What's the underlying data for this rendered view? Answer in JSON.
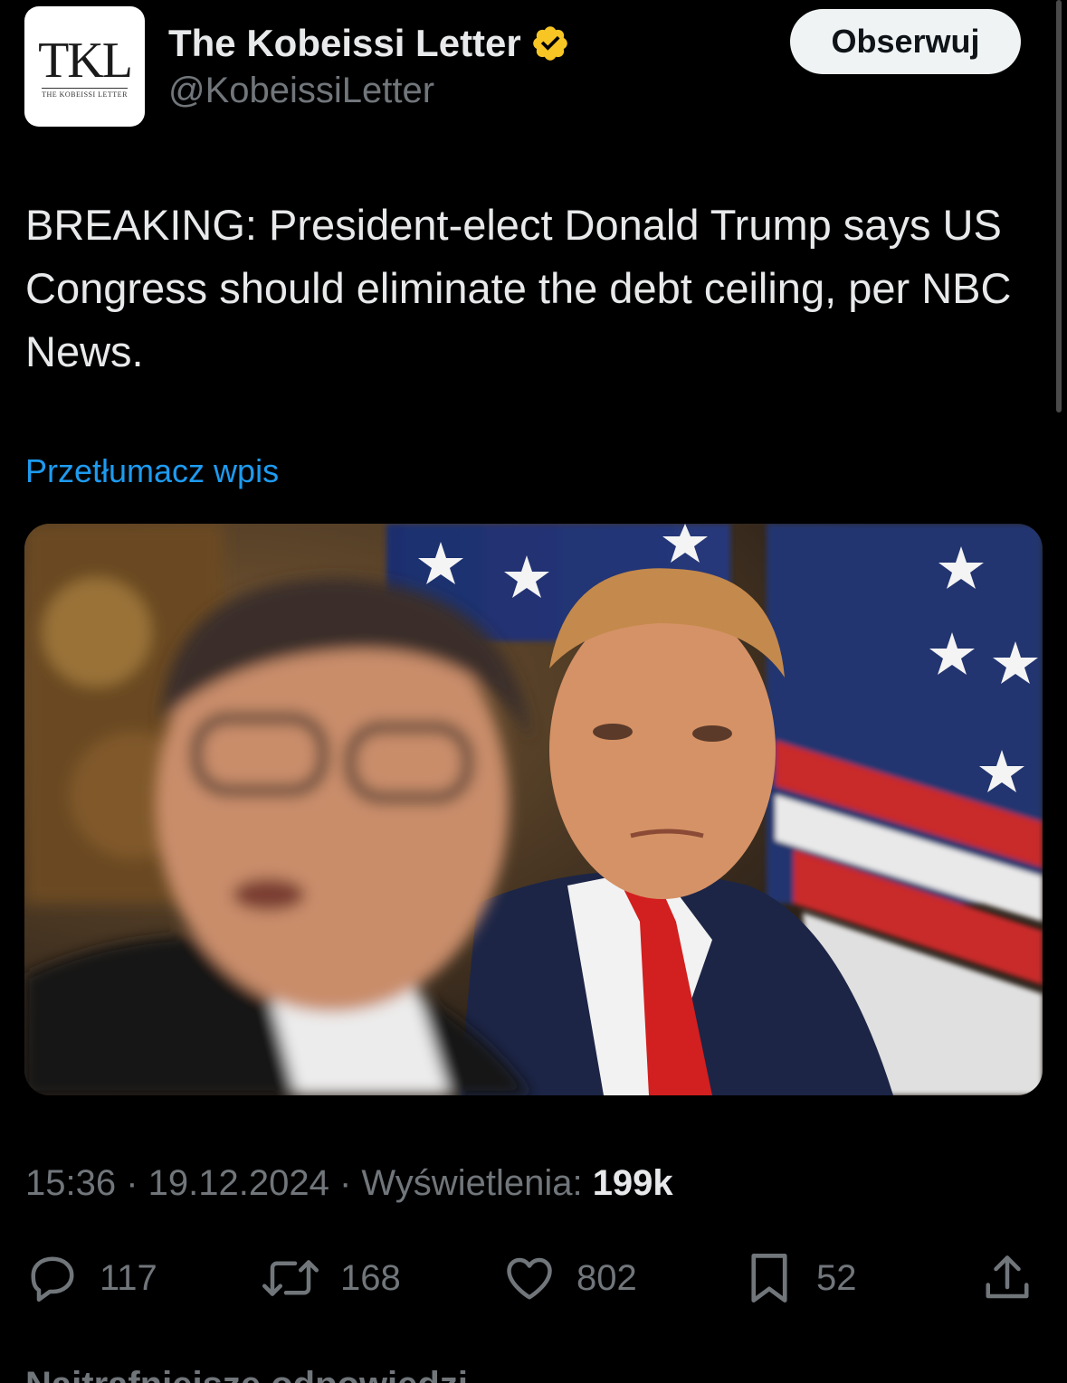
{
  "author": {
    "display_name": "The Kobeissi Letter",
    "handle": "@KobeissiLetter",
    "avatar_logo": "TKL",
    "avatar_tagline": "THE KOBEISSI LETTER",
    "verified_icon": "verified-badge-icon",
    "verified_color": "#f7c624"
  },
  "follow_button": {
    "label": "Obserwuj"
  },
  "tweet": {
    "text": "BREAKING: President-elect Donald Trump says US Congress should eliminate the debt ceiling, per NBC News.",
    "translate_label": "Przetłumacz wpis"
  },
  "meta": {
    "time": "15:36",
    "separator": " · ",
    "date": "19.12.2024",
    "views_label": "Wyświetlenia: ",
    "views_count": "199k"
  },
  "actions": {
    "reply": {
      "icon": "reply-icon",
      "count": "117"
    },
    "retweet": {
      "icon": "retweet-icon",
      "count": "168"
    },
    "like": {
      "icon": "heart-icon",
      "count": "802"
    },
    "bookmark": {
      "icon": "bookmark-icon",
      "count": "52"
    },
    "share": {
      "icon": "share-icon"
    }
  },
  "bottom_peek": {
    "label": "Najtrafniejsze odpowiedzi ⌄"
  },
  "colors": {
    "background": "#000000",
    "text_primary": "#e7e9ea",
    "text_secondary": "#71767b",
    "link": "#1d9bf0"
  }
}
